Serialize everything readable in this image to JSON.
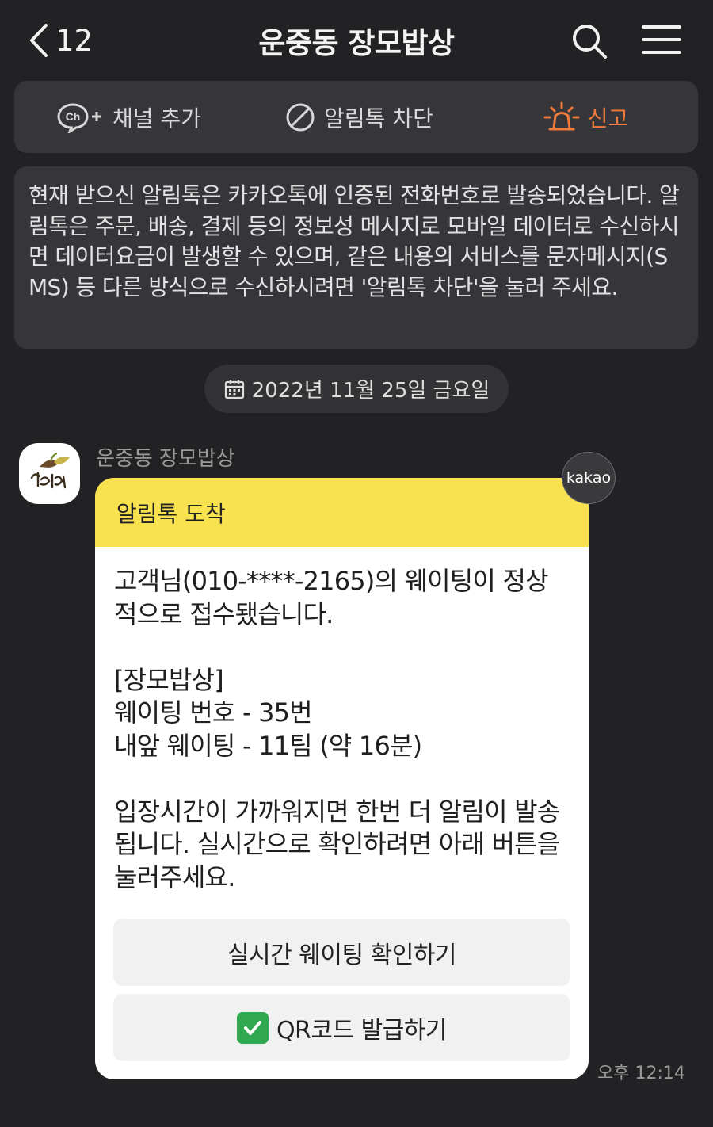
{
  "header": {
    "back_count": "12",
    "title": "운중동 장모밥상"
  },
  "actions": {
    "add_channel": "채널 추가",
    "ch_badge": "Ch",
    "block": "알림톡 차단",
    "report": "신고"
  },
  "notice": "현재 받으신 알림톡은 카카오톡에 인증된 전화번호로 발송되었습니다. 알림톡은 주문, 배송, 결제 등의 정보성 메시지로 모바일 데이터로 수신하시면 데이터요금이 발생할 수 있으며, 같은 내용의 서비스를 문자메시지(SMS) 등 다른 방식으로 수신하시려면 '알림톡 차단'을 눌러 주세요.",
  "date": "2022년 11월 25일 금요일",
  "message": {
    "sender": "운중동 장모밥상",
    "card_title": "알림톡 도착",
    "paragraph1": "고객님(010-****-2165)의 웨이팅이 정상적으로 접수됐습니다.",
    "shop_line": "[장모밥상]",
    "waiting_number": "웨이팅 번호 - 35번",
    "waiting_ahead": "내앞 웨이팅 - 11팀 (약 16분)",
    "paragraph3": "입장시간이 가까워지면 한번 더 알림이 발송됩니다. 실시간으로 확인하려면 아래 버튼을 눌러주세요.",
    "button_realtime": "실시간 웨이팅 확인하기",
    "button_qr": "QR코드 발급하기",
    "badge": "kakao",
    "time": "오후 12:14"
  },
  "colors": {
    "background": "#222225",
    "panel": "#36363a",
    "card_header": "#f9e24f",
    "report_accent": "#f07b3a",
    "check_green": "#2fa84f"
  }
}
